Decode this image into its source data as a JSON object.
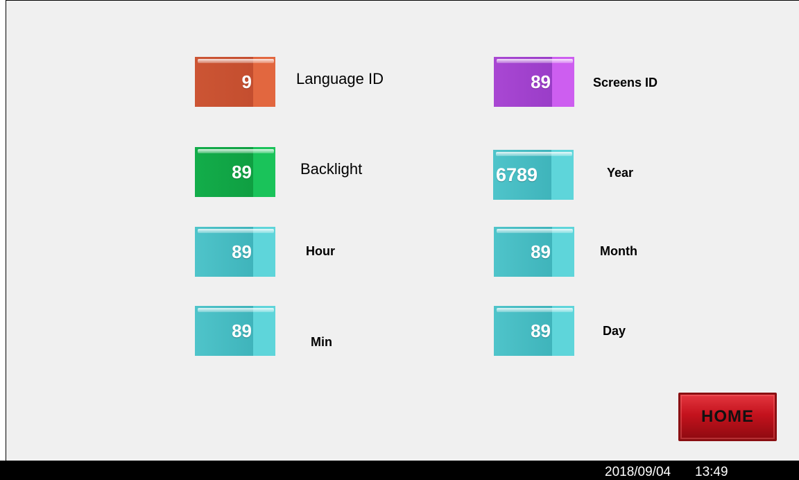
{
  "colors": {
    "screen_bg": "#f0f0f0",
    "orange": "#e2673f",
    "purple": "#cd5ef0",
    "green": "#1ac35a",
    "cyan": "#5ed5da",
    "home_red": "#c4121d",
    "status_bar": "#000000"
  },
  "fields": {
    "language_id": {
      "value": "9",
      "label": "Language ID"
    },
    "screens_id": {
      "value": "89",
      "label": "Screens ID"
    },
    "backlight": {
      "value": "89",
      "label": "Backlight"
    },
    "year": {
      "value": "6789",
      "label": "Year"
    },
    "hour": {
      "value": "89",
      "label": "Hour"
    },
    "month": {
      "value": "89",
      "label": "Month"
    },
    "min": {
      "value": "89",
      "label": "Min"
    },
    "day": {
      "value": "89",
      "label": "Day"
    }
  },
  "home_button": {
    "label": "HOME"
  },
  "status_bar": {
    "date": "2018/09/04",
    "time": "13:49"
  }
}
